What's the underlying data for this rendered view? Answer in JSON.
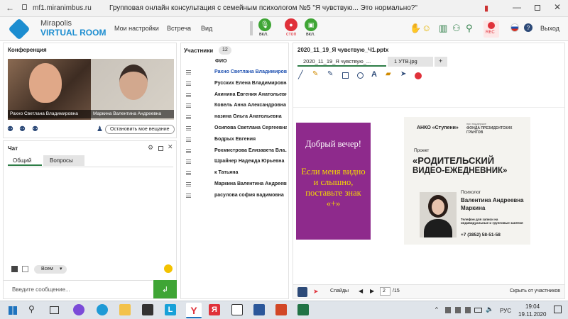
{
  "browser": {
    "url": "mf1.miranimbus.ru",
    "page_title": "Групповая онлайн консультация с семейным психологом №5 \"Я чувствую... Это нормально?\""
  },
  "app": {
    "logo_top": "Mirapolis",
    "logo_bottom": "VIRTUAL ROOM",
    "menu": [
      "Мои настройки",
      "Встреча",
      "Вид"
    ],
    "mic_label": "вкл.",
    "rec_label": "стоп",
    "cam_label": "вкл.",
    "rec_badge": "REC",
    "exit_label": "Выход"
  },
  "conference": {
    "title": "Конференция",
    "video1_name": "Рахно Светлана Владимировна",
    "video2_name": "Маркина Валентина Андреевна",
    "stop_broadcast": "Остановить мое вещание"
  },
  "chat": {
    "title": "Чат",
    "tabs": [
      "Общий",
      "Вопросы"
    ],
    "recipient": "Всем",
    "placeholder": "Введите сообщение..."
  },
  "participants": {
    "title": "Участники",
    "count": "12",
    "column": "ФИО",
    "list": [
      "Рахно Светлана Владимировна",
      "Русских Елена Владимировна",
      "Акинина Евгения Анатольевна",
      "Ковель Анна Александровна",
      "назина Ольга Анатольевна",
      "Осипова Светлана Сергеевна",
      "Бодрых Евгения",
      "Рохмистрова Елизавета Вла...",
      "Шрайнер Надежда Юрьевна",
      "к Татьяна",
      "Маркина Валентина Андреевн",
      "расулова софия вадимовна"
    ]
  },
  "document": {
    "filename": "2020_11_19_Я чувствую_Ч1.pptx",
    "tabs": [
      "2020_11_19_Я чувствую_...",
      "1 УТВ.jpg",
      "+"
    ],
    "slide_left": {
      "greeting": "Добрый вечер!",
      "text": "Если меня видно и слышно, поставьте знак «+»"
    },
    "slide_right": {
      "org": "АНКО «Ступени»",
      "fund_small": "при поддержке",
      "fund": "ФОНДА ПРЕЗИДЕНТСКИХ ГРАНТОВ",
      "project": "Проект",
      "project_title_1": "«РОДИТЕЛЬСКИЙ",
      "project_title_2": "ВИДЕО-ЕЖЕДНЕВНИК»",
      "role": "Психолог",
      "person_1": "Валентина Андреевна",
      "person_2": "Маркина",
      "phone_note": "Телефон для записи на индивидуальные и групповые занятия",
      "phone": "+7 (3852) 58-51-58"
    },
    "bottom": {
      "slides_label": "Слайды",
      "page": "2",
      "total": "/15",
      "hide": "Скрыть от участников"
    }
  },
  "taskbar": {
    "lang": "РУС",
    "time": "19:04",
    "date": "19.11.2020"
  },
  "colors": {
    "purple": "#8e2a8c",
    "green": "#3fa535",
    "red": "#e0313a"
  }
}
